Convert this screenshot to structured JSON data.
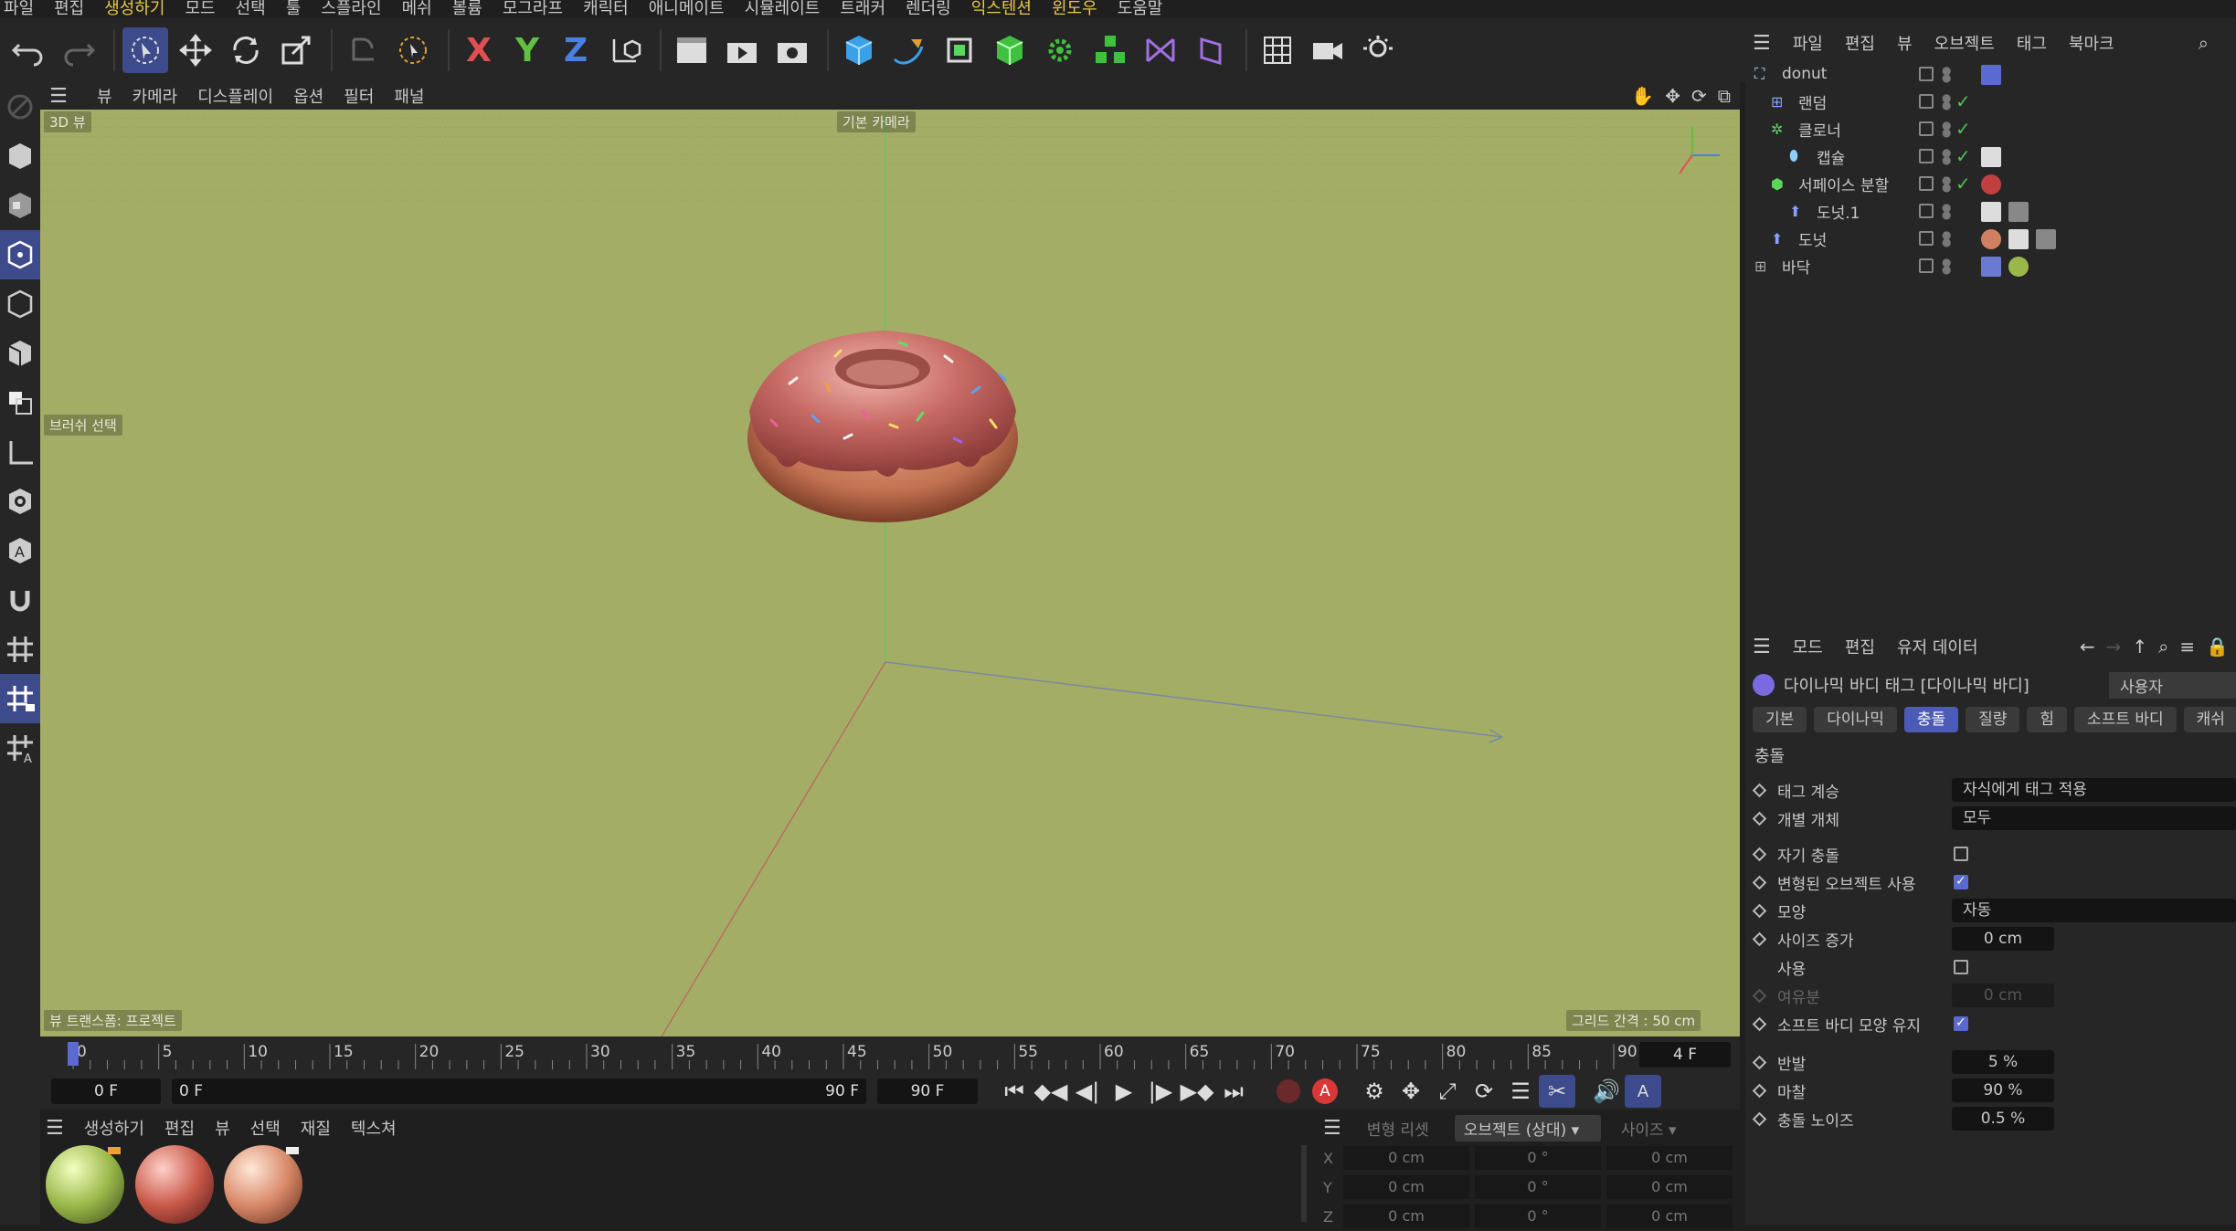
{
  "menubar": [
    "파일",
    "편집",
    "생성하기",
    "모드",
    "선택",
    "툴",
    "스플라인",
    "메쉬",
    "볼륨",
    "모그라프",
    "캐릭터",
    "애니메이트",
    "시뮬레이트",
    "트래커",
    "렌더링",
    "익스텐션",
    "윈도우",
    "도움말"
  ],
  "toolbar": {
    "axis_x": "X",
    "axis_y": "Y",
    "axis_z": "Z",
    "accent": "#5b6ad0"
  },
  "viewport_menu": [
    "뷰",
    "카메라",
    "디스플레이",
    "옵션",
    "필터",
    "패널"
  ],
  "viewport": {
    "view_name": "3D 뷰",
    "camera": "기본 카메라",
    "brush": "브러쉬 선택",
    "projection": "뷰 트랜스폼: 프로젝트",
    "grid": "그리드 간격 : 50 cm",
    "bg_color": "#a3ad65"
  },
  "timeline": {
    "ticks": [
      "0",
      "5",
      "10",
      "15",
      "20",
      "25",
      "30",
      "35",
      "40",
      "45",
      "50",
      "55",
      "60",
      "65",
      "70",
      "75",
      "80",
      "85",
      "90"
    ],
    "current_frame": "4 F",
    "start": "0 F",
    "range_start": "0 F",
    "range_end": "90 F",
    "end": "90 F",
    "record_label": "A"
  },
  "material_menu": [
    "생성하기",
    "편집",
    "뷰",
    "선택",
    "재질",
    "텍스쳐"
  ],
  "coords": {
    "transform_reset": "변형 리셋",
    "mode": "오브젝트 (상대)",
    "size": "사이즈",
    "rows": [
      {
        "axis": "X",
        "pos": "0 cm",
        "rot": "0 °",
        "size": "0 cm"
      },
      {
        "axis": "Y",
        "pos": "0 cm",
        "rot": "0 °",
        "size": "0 cm"
      },
      {
        "axis": "Z",
        "pos": "0 cm",
        "rot": "0 °",
        "size": "0 cm"
      }
    ]
  },
  "object_menu": [
    "파일",
    "편집",
    "뷰",
    "오브젝트",
    "태그",
    "북마크"
  ],
  "objects": [
    {
      "name": "donut",
      "check": false
    },
    {
      "name": "랜덤",
      "check": true
    },
    {
      "name": "클로너",
      "check": true
    },
    {
      "name": "캡슐",
      "check": true
    },
    {
      "name": "서페이스 분할",
      "check": true
    },
    {
      "name": "도넛.1",
      "check": false
    },
    {
      "name": "도넛",
      "check": false
    },
    {
      "name": "바닥",
      "check": false
    }
  ],
  "attr_menu": [
    "모드",
    "편집",
    "유저 데이터"
  ],
  "attr_title": "다이나믹 바디 태그 [다이나믹 바디]",
  "attr_preset": "사용자",
  "attr_tabs": [
    "기본",
    "다이나믹",
    "충돌",
    "질량",
    "힘",
    "소프트 바디",
    "캐쉬"
  ],
  "section": "충돌",
  "fields": {
    "tag_inherit_label": "태그 계승",
    "tag_inherit": "자식에게 태그 적용",
    "individual_label": "개별 개체",
    "individual": "모두",
    "self_collision": "자기 충돌",
    "deformed": "변형된 오브젝트 사용",
    "shape_label": "모양",
    "shape": "자동",
    "size_inc_label": "사이즈 증가",
    "size_inc": "0 cm",
    "use": "사용",
    "margin_label": "여유분",
    "margin": "0 cm",
    "keep_soft": "소프트 바디 모양 유지",
    "bounce_label": "반발",
    "bounce": "5 %",
    "friction_label": "마찰",
    "friction": "90 %",
    "noise_label": "충돌 노이즈",
    "noise": "0.5 %"
  }
}
